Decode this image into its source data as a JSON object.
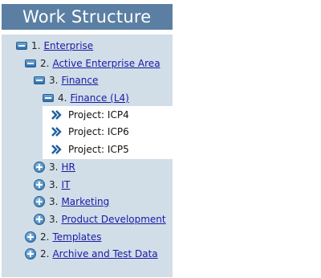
{
  "header": {
    "title": "Work Structure"
  },
  "colors": {
    "header_bg": "#5a7fa3",
    "panel_bg": "#d1dee8",
    "link": "#1a1aa6",
    "icon": "#2f6fae"
  },
  "tree": {
    "enterprise": {
      "num": "1.",
      "label": "Enterprise",
      "icon": "collapse-icon"
    },
    "active_area": {
      "num": "2.",
      "label": "Active Enterprise Area",
      "icon": "collapse-icon"
    },
    "finance": {
      "num": "3.",
      "label": "Finance",
      "icon": "collapse-icon"
    },
    "finance_l4": {
      "num": "4.",
      "label": "Finance (L4)",
      "icon": "collapse-icon"
    },
    "projects": [
      {
        "label": "Project: ICP4",
        "icon": "chevron-right-icon"
      },
      {
        "label": "Project: ICP6",
        "icon": "chevron-right-icon"
      },
      {
        "label": "Project: ICP5",
        "icon": "chevron-right-icon"
      }
    ],
    "hr": {
      "num": "3.",
      "label": "HR",
      "icon": "expand-icon"
    },
    "it": {
      "num": "3.",
      "label": "IT",
      "icon": "expand-icon"
    },
    "marketing": {
      "num": "3.",
      "label": "Marketing",
      "icon": "expand-icon"
    },
    "product_dev": {
      "num": "3.",
      "label": "Product Development",
      "icon": "expand-icon"
    },
    "templates": {
      "num": "2.",
      "label": "Templates",
      "icon": "expand-icon"
    },
    "archive": {
      "num": "2.",
      "label": "Archive and Test Data",
      "icon": "expand-icon"
    }
  }
}
